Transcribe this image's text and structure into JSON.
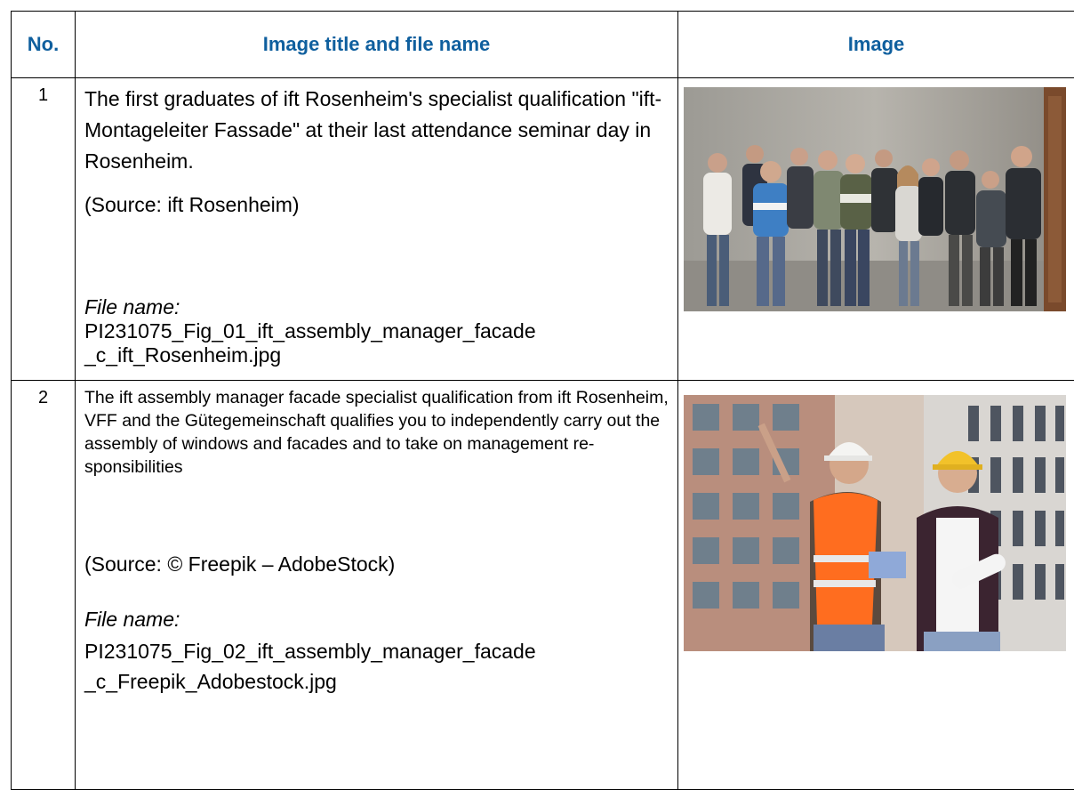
{
  "table": {
    "headers": {
      "no": "No.",
      "title": "Image title and file name",
      "image": "Image"
    },
    "rows": [
      {
        "no": "1",
        "title": "The first graduates of ift Rosenheim's specialist qualification \"ift-Montageleiter Fassade\" at their last attendance seminar day in Rosenheim.",
        "source": "(Source: ift Rosenheim)",
        "file_label": "File name:",
        "file_name_line1": "PI231075_Fig_01_ift_assembly_manager_facade",
        "file_name_line2": "_c_ift_Rosenheim.jpg"
      },
      {
        "no": "2",
        "title": "The ift assembly manager facade specialist qualification from ift Rosenheim, VFF and the Gütegemeinschaft qualifies you to independently carry out the assembly of windows and facades and to take on management re-sponsibilities",
        "source": "(Source: © Freepik – AdobeStock)",
        "file_label": "File name:",
        "file_name_line1": "PI231075_Fig_02_ift_assembly_manager_facade",
        "file_name_line2": "_c_Freepik_Adobestock.jpg"
      }
    ]
  },
  "colors": {
    "header_text": "#0f5f9e",
    "border": "#000000"
  }
}
